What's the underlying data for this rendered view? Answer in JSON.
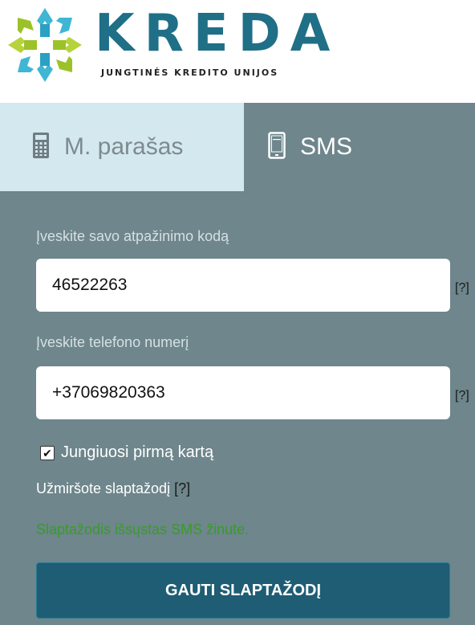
{
  "brand": {
    "name": "KREDA",
    "tagline": "JUNGTINĖS KREDITO UNIJOS",
    "logo_icon": "snowflake-logo-icon",
    "colors": {
      "primary": "#1f6f87",
      "lime": "#b7d33b",
      "cyan": "#3fb6d4"
    }
  },
  "tabs": [
    {
      "label": "M. parašas",
      "icon": "calculator-icon",
      "active": false
    },
    {
      "label": "SMS",
      "icon": "phone-icon",
      "active": true
    }
  ],
  "form": {
    "code_label": "Įveskite savo atpažinimo kodą",
    "code_value": "46522263",
    "phone_label": "Įveskite telefono numerį",
    "phone_value": "+37069820363",
    "help_text": "[?]",
    "first_time_label": "Jungiuosi pirmą kartą",
    "first_time_checked": true,
    "forgot_text": "Užmiršote slaptažodį",
    "success_message": "Slaptažodis išsųstas SMS žinute.",
    "submit_label": "GAUTI SLAPTAŽODĮ"
  },
  "colors": {
    "panel": "#6e868c",
    "inactive_tab": "#d4e8ef",
    "button": "#1e5d74",
    "success": "#3a9a2b"
  }
}
